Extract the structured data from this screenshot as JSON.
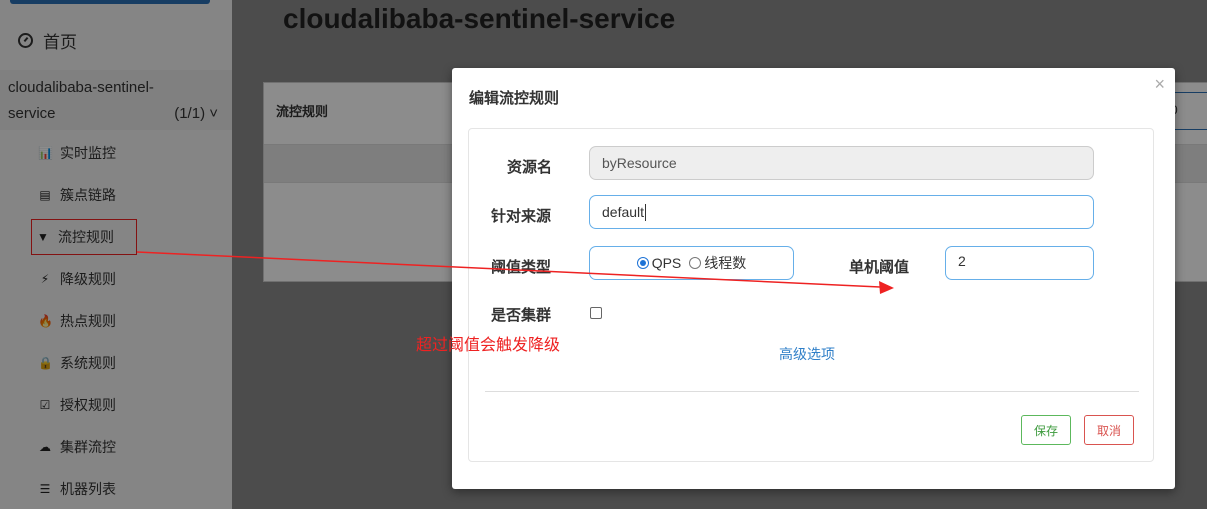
{
  "app": {
    "title": "cloudalibaba-sentinel-service"
  },
  "sidebar": {
    "home_label": "首页",
    "app_name_line1": "cloudalibaba-sentinel-",
    "app_name_line2": "service",
    "app_count": "(1/1)",
    "items": [
      {
        "icon": "bar-chart-icon",
        "glyph": "📊",
        "label": "实时监控"
      },
      {
        "icon": "list-icon",
        "glyph": "▤",
        "label": "簇点链路"
      },
      {
        "icon": "filter-icon",
        "glyph": "▼",
        "label": "流控规则"
      },
      {
        "icon": "bolt-icon",
        "glyph": "⚡",
        "label": "降级规则"
      },
      {
        "icon": "fire-icon",
        "glyph": "🔥",
        "label": "热点规则"
      },
      {
        "icon": "lock-icon",
        "glyph": "🔒",
        "label": "系统规则"
      },
      {
        "icon": "check-square-icon",
        "glyph": "☑",
        "label": "授权规则"
      },
      {
        "icon": "cloud-icon",
        "glyph": "☁",
        "label": "集群流控"
      },
      {
        "icon": "th-list-icon",
        "glyph": "☰",
        "label": "机器列表"
      }
    ]
  },
  "background_panel": {
    "header": "流控规则",
    "search_value": "0"
  },
  "modal": {
    "title": "编辑流控规则",
    "close_glyph": "×",
    "fields": {
      "resource_label": "资源名",
      "resource_value": "byResource",
      "source_label": "针对来源",
      "source_value": "default",
      "threshold_type_label": "阈值类型",
      "radio_qps": "QPS",
      "radio_threads": "线程数",
      "threshold_type_selected": "QPS",
      "single_threshold_label": "单机阈值",
      "single_threshold_value": "2",
      "cluster_label": "是否集群",
      "cluster_checked": false
    },
    "advanced_link": "高级选项",
    "save_button": "保存",
    "cancel_button": "取消"
  },
  "annotation": {
    "text": "超过阈值会触发降级",
    "color": "#ee2222"
  }
}
